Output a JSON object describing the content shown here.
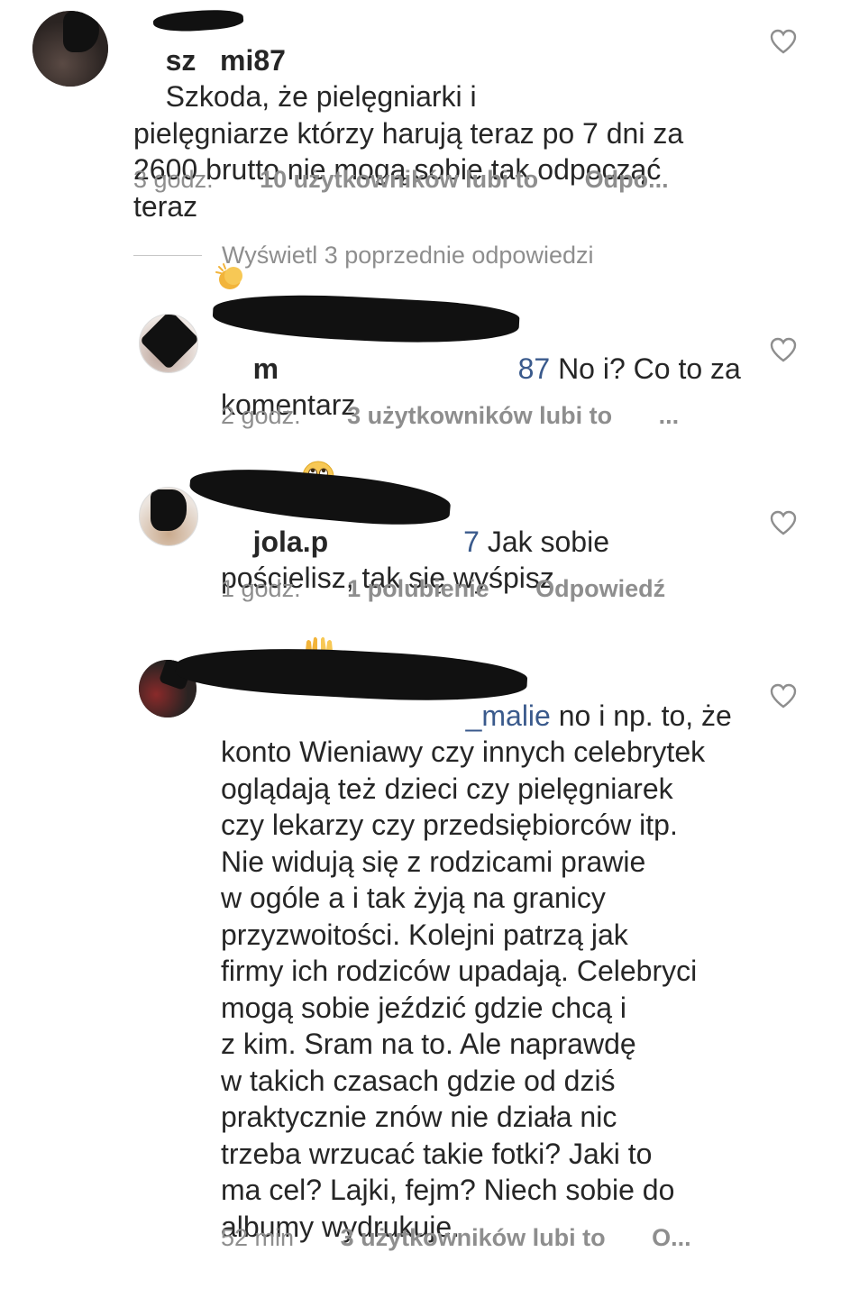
{
  "comments": [
    {
      "username_visible": "sz   mi87",
      "text": "Szkoda, że pielęgniarki i\npielęgniarze którzy harują teraz po 7 dni za\n2600 brutto nie mogą sobie tak odpocząć\nteraz",
      "emoji": "clapping-hands",
      "time": "3 godz.",
      "likes": "10 użytkowników lubi to",
      "reply": "Odpo..."
    },
    {
      "username_visible": "m    ",
      "mention_visible": "87",
      "text": "No i? Co to za\nkomentarz",
      "emoji": "rolling-eyes",
      "time": "2 godz.",
      "likes": "3 użytkowników lubi to",
      "reply": "..."
    },
    {
      "username_visible": "jola.p",
      "mention_visible": "7",
      "text": "Jak sobie\npościelisz, tak się wyśpisz",
      "emoji": "raising-hands",
      "time": "1 godz.",
      "likes": "1 polubienie",
      "reply": "Odpowiedź"
    },
    {
      "username_visible": "",
      "mention_visible": "_malie",
      "text": "no i np. to, że\nkonto Wieniawy czy innych celebrytek\noglądają też dzieci czy pielęgniarek\nczy lekarzy czy przedsiębiorców itp.\nNie widują się z rodzicami prawie\nw ogóle a i tak żyją na granicy\nprzyzwoitości. Kolejni patrzą jak\nfirmy ich rodziców upadają. Celebryci\nmogą sobie jeździć gdzie chcą i\nz kim. Sram na to. Ale naprawdę\nw takich czasach gdzie od dziś\npraktycznie znów nie działa nic\ntrzeba wrzucać takie fotki? Jaki to\nma cel? Lajki, fejm? Niech sobie do\nalbumy wydrukuje.",
      "time": "52 min",
      "likes": "3 użytkowników lubi to",
      "reply": "O..."
    }
  ],
  "view_replies": "Wyświetl 3 poprzednie odpowiedzi",
  "icons": {
    "like": "heart-outline-icon"
  },
  "colors": {
    "text": "#262626",
    "meta": "#8e8e8e",
    "mention": "#3a5a8c",
    "redaction": "#111111"
  }
}
